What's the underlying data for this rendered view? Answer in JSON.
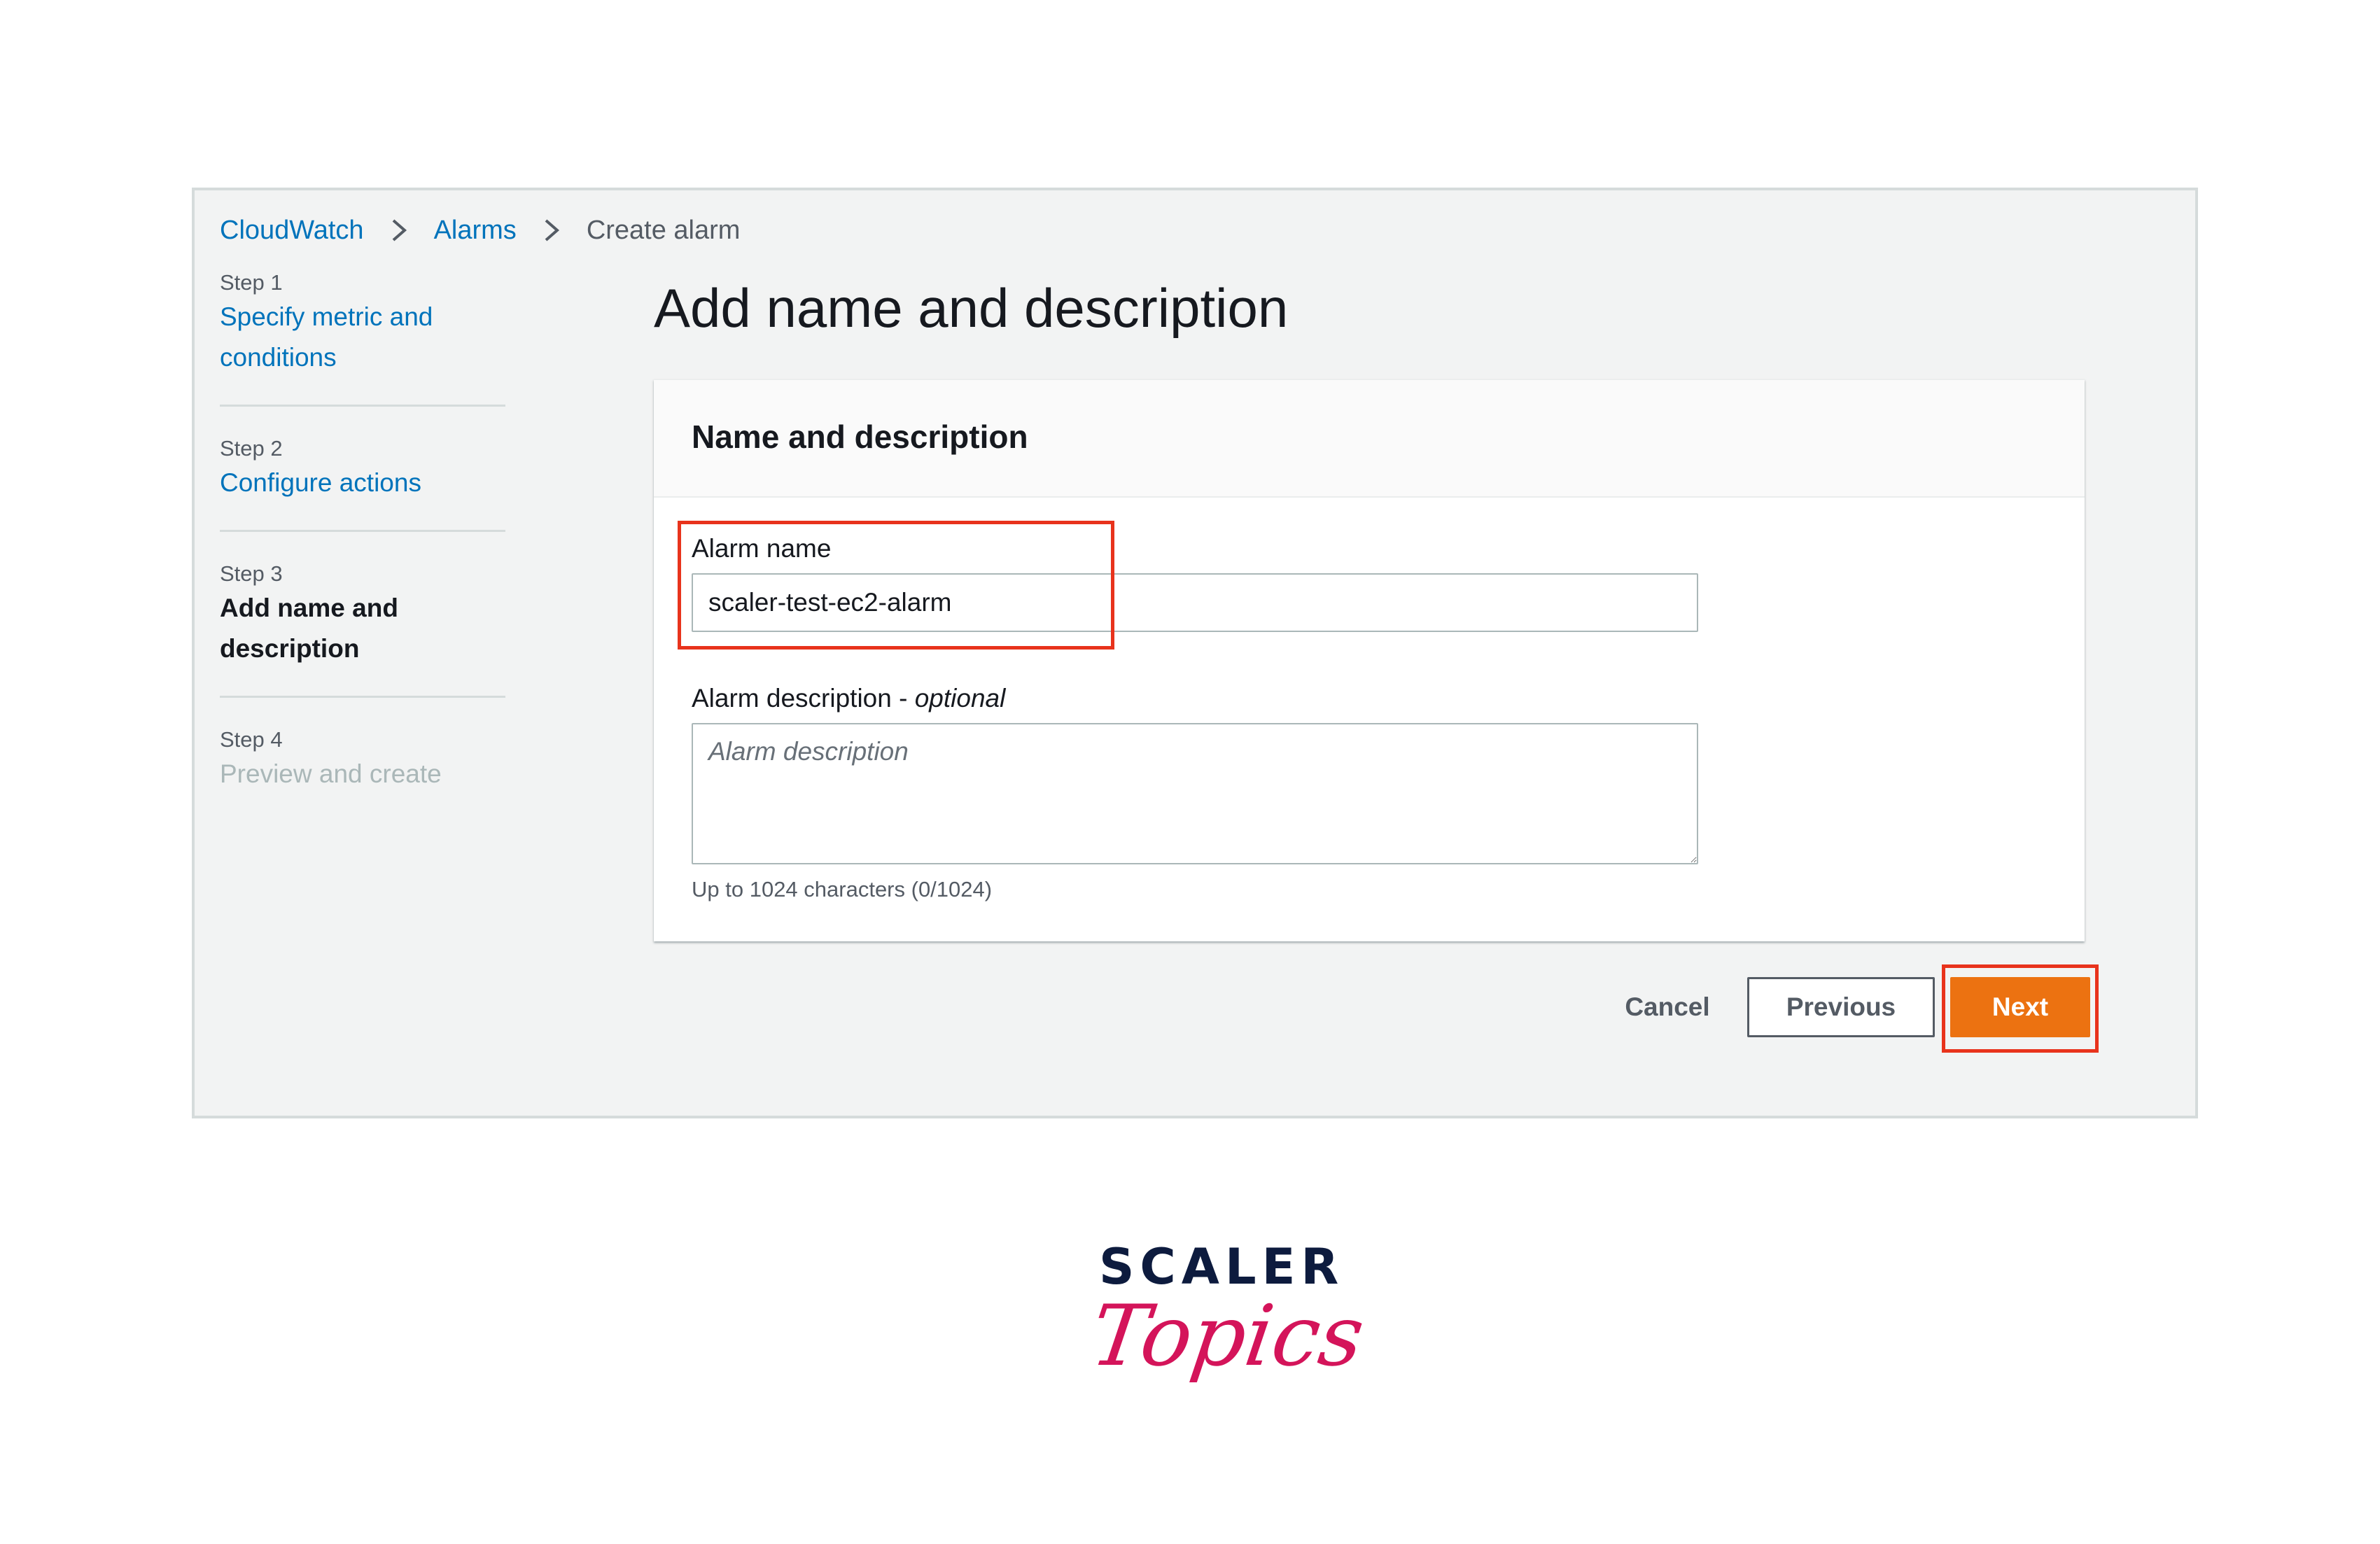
{
  "breadcrumb": {
    "items": [
      "CloudWatch",
      "Alarms",
      "Create alarm"
    ]
  },
  "steps": [
    {
      "number": "Step 1",
      "label": "Specify metric and conditions",
      "state": "link"
    },
    {
      "number": "Step 2",
      "label": "Configure actions",
      "state": "link"
    },
    {
      "number": "Step 3",
      "label": "Add name and description",
      "state": "current"
    },
    {
      "number": "Step 4",
      "label": "Preview and create",
      "state": "disabled"
    }
  ],
  "page": {
    "title": "Add name and description"
  },
  "panel": {
    "title": "Name and description",
    "alarm_name": {
      "label": "Alarm name",
      "value": "scaler-test-ec2-alarm"
    },
    "alarm_description": {
      "label": "Alarm description - ",
      "label_optional": "optional",
      "placeholder": "Alarm description",
      "hint": "Up to 1024 characters (0/1024)"
    }
  },
  "actions": {
    "cancel": "Cancel",
    "previous": "Previous",
    "next": "Next"
  },
  "logo": {
    "line1": "SCALER",
    "line2": "Topics"
  },
  "colors": {
    "link": "#0073bb",
    "primary_button": "#ec7211",
    "highlight": "#e8331c",
    "logo_dark": "#0d1b3e",
    "logo_pink": "#d4145a"
  }
}
